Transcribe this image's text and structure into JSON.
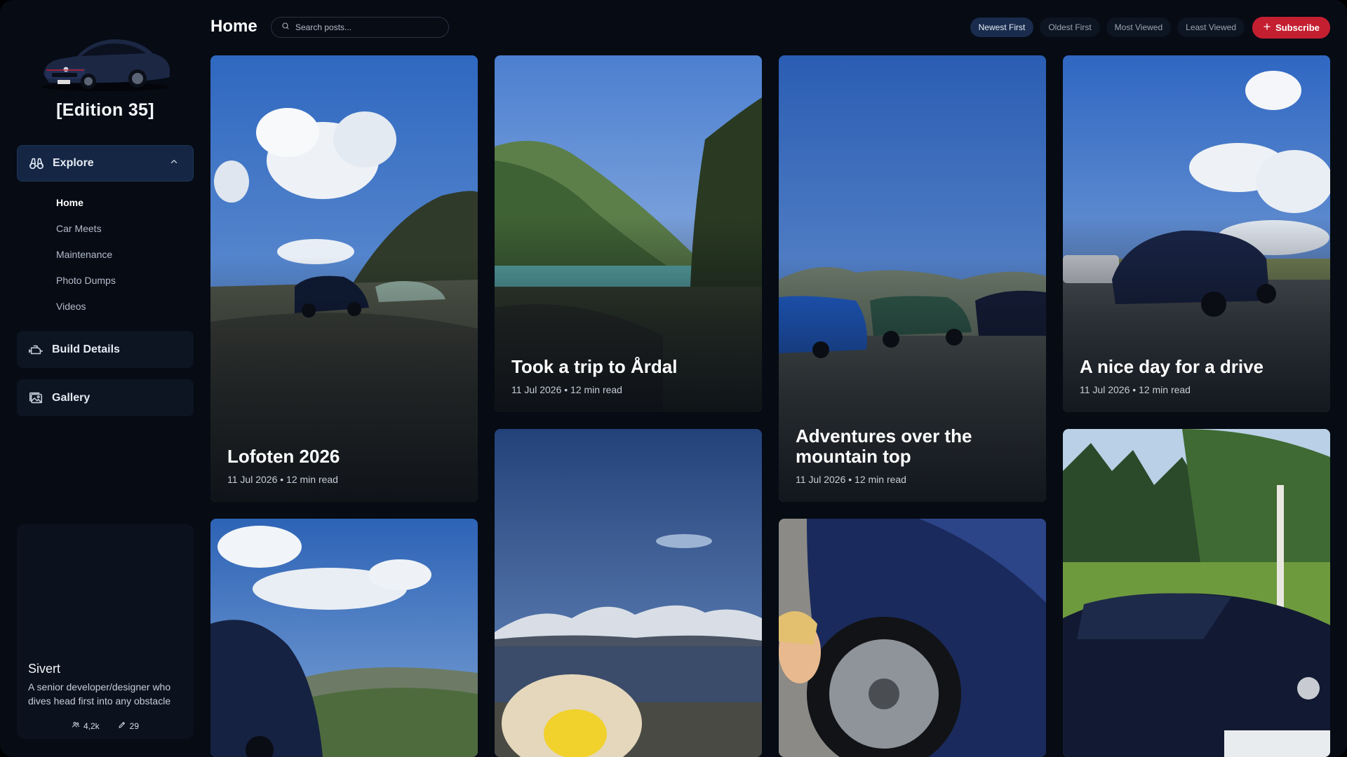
{
  "brand": {
    "name": "[Edition 35]"
  },
  "header": {
    "title": "Home",
    "search_placeholder": "Search posts...",
    "sort_options": [
      "Newest First",
      "Oldest First",
      "Most Viewed",
      "Least Viewed"
    ],
    "active_sort": "Newest First",
    "subscribe_label": "Subscribe"
  },
  "sidebar": {
    "explore_label": "Explore",
    "explore_items": [
      "Home",
      "Car Meets",
      "Maintenance",
      "Photo Dumps",
      "Videos"
    ],
    "current_item": "Home",
    "build_details_label": "Build Details",
    "gallery_label": "Gallery"
  },
  "profile": {
    "name": "Sivert",
    "bio": "A senior developer/designer who dives head first into any obstacle",
    "followers": "4,2k",
    "posts": "29"
  },
  "posts": [
    {
      "title": "Lofoten 2026",
      "meta": "11 Jul 2026 • 12 min read"
    },
    {
      "title": "Took a trip to Årdal",
      "meta": "11 Jul 2026 • 12 min read"
    },
    {
      "title": "Adventures over the mountain top",
      "meta": "11 Jul 2026 • 12 min read"
    },
    {
      "title": "A nice day for a drive",
      "meta": "11 Jul 2026 • 12 min read"
    }
  ],
  "colors": {
    "background": "#060b14",
    "accent_red": "#c41f31",
    "active_nav": "#142644"
  }
}
